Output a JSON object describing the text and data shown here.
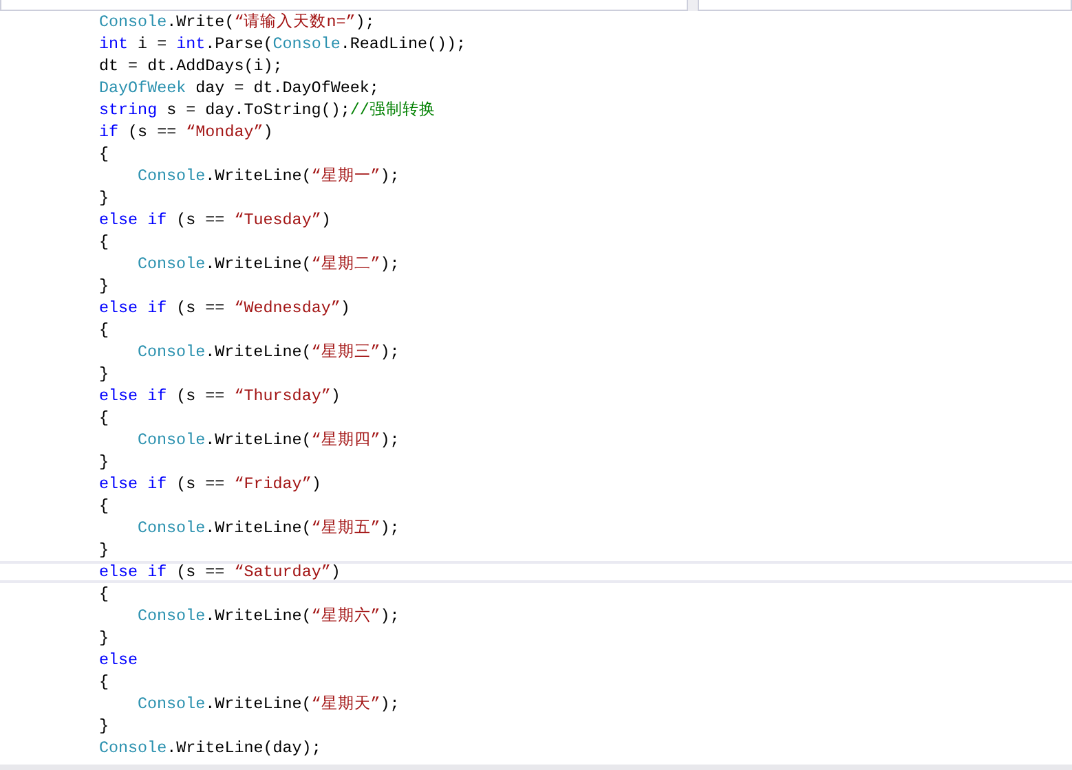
{
  "code_lines": [
    {
      "current": false,
      "tokens": [
        {
          "kind": "type",
          "text": "Console"
        },
        {
          "kind": "plain",
          "text": ".Write("
        },
        {
          "kind": "string",
          "text": "“请输入天数n=”"
        },
        {
          "kind": "plain",
          "text": ");"
        }
      ]
    },
    {
      "current": false,
      "tokens": [
        {
          "kind": "keyword",
          "text": "int"
        },
        {
          "kind": "plain",
          "text": " i = "
        },
        {
          "kind": "keyword",
          "text": "int"
        },
        {
          "kind": "plain",
          "text": ".Parse("
        },
        {
          "kind": "type",
          "text": "Console"
        },
        {
          "kind": "plain",
          "text": ".ReadLine());"
        }
      ]
    },
    {
      "current": false,
      "tokens": [
        {
          "kind": "plain",
          "text": "dt = dt.AddDays(i);"
        }
      ]
    },
    {
      "current": false,
      "tokens": [
        {
          "kind": "type",
          "text": "DayOfWeek"
        },
        {
          "kind": "plain",
          "text": " day = dt.DayOfWeek;"
        }
      ]
    },
    {
      "current": false,
      "tokens": [
        {
          "kind": "keyword",
          "text": "string"
        },
        {
          "kind": "plain",
          "text": " s = day.ToString();"
        },
        {
          "kind": "comment",
          "text": "//强制转换"
        }
      ]
    },
    {
      "current": false,
      "tokens": [
        {
          "kind": "keyword",
          "text": "if"
        },
        {
          "kind": "plain",
          "text": " (s == "
        },
        {
          "kind": "string",
          "text": "“Monday”"
        },
        {
          "kind": "plain",
          "text": ")"
        }
      ]
    },
    {
      "current": false,
      "tokens": [
        {
          "kind": "plain",
          "text": "{"
        }
      ],
      "children": [
        {
          "current": false,
          "tokens": [
            {
              "kind": "type",
              "text": "Console"
            },
            {
              "kind": "plain",
              "text": ".WriteLine("
            },
            {
              "kind": "string",
              "text": "“星期一”"
            },
            {
              "kind": "plain",
              "text": ");"
            }
          ]
        }
      ]
    },
    {
      "current": false,
      "tokens": [
        {
          "kind": "plain",
          "text": "}"
        }
      ]
    },
    {
      "current": false,
      "tokens": [
        {
          "kind": "keyword",
          "text": "else if"
        },
        {
          "kind": "plain",
          "text": " (s == "
        },
        {
          "kind": "string",
          "text": "“Tuesday”"
        },
        {
          "kind": "plain",
          "text": ")"
        }
      ]
    },
    {
      "current": false,
      "tokens": [
        {
          "kind": "plain",
          "text": "{"
        }
      ],
      "children": [
        {
          "current": false,
          "tokens": [
            {
              "kind": "type",
              "text": "Console"
            },
            {
              "kind": "plain",
              "text": ".WriteLine("
            },
            {
              "kind": "string",
              "text": "“星期二”"
            },
            {
              "kind": "plain",
              "text": ");"
            }
          ]
        }
      ]
    },
    {
      "current": false,
      "tokens": [
        {
          "kind": "plain",
          "text": "}"
        }
      ]
    },
    {
      "current": false,
      "tokens": [
        {
          "kind": "keyword",
          "text": "else if"
        },
        {
          "kind": "plain",
          "text": " (s == "
        },
        {
          "kind": "string",
          "text": "“Wednesday”"
        },
        {
          "kind": "plain",
          "text": ")"
        }
      ]
    },
    {
      "current": false,
      "tokens": [
        {
          "kind": "plain",
          "text": "{"
        }
      ],
      "children": [
        {
          "current": false,
          "tokens": [
            {
              "kind": "type",
              "text": "Console"
            },
            {
              "kind": "plain",
              "text": ".WriteLine("
            },
            {
              "kind": "string",
              "text": "“星期三”"
            },
            {
              "kind": "plain",
              "text": ");"
            }
          ]
        }
      ]
    },
    {
      "current": false,
      "tokens": [
        {
          "kind": "plain",
          "text": "}"
        }
      ]
    },
    {
      "current": false,
      "tokens": [
        {
          "kind": "keyword",
          "text": "else if"
        },
        {
          "kind": "plain",
          "text": " (s == "
        },
        {
          "kind": "string",
          "text": "“Thursday”"
        },
        {
          "kind": "plain",
          "text": ")"
        }
      ]
    },
    {
      "current": false,
      "tokens": [
        {
          "kind": "plain",
          "text": "{"
        }
      ],
      "children": [
        {
          "current": false,
          "tokens": [
            {
              "kind": "type",
              "text": "Console"
            },
            {
              "kind": "plain",
              "text": ".WriteLine("
            },
            {
              "kind": "string",
              "text": "“星期四”"
            },
            {
              "kind": "plain",
              "text": ");"
            }
          ]
        }
      ]
    },
    {
      "current": false,
      "tokens": [
        {
          "kind": "plain",
          "text": "}"
        }
      ]
    },
    {
      "current": false,
      "tokens": [
        {
          "kind": "keyword",
          "text": "else if"
        },
        {
          "kind": "plain",
          "text": " (s == "
        },
        {
          "kind": "string",
          "text": "“Friday”"
        },
        {
          "kind": "plain",
          "text": ")"
        }
      ]
    },
    {
      "current": false,
      "tokens": [
        {
          "kind": "plain",
          "text": "{"
        }
      ],
      "children": [
        {
          "current": false,
          "tokens": [
            {
              "kind": "type",
              "text": "Console"
            },
            {
              "kind": "plain",
              "text": ".WriteLine("
            },
            {
              "kind": "string",
              "text": "“星期五”"
            },
            {
              "kind": "plain",
              "text": ");"
            }
          ]
        }
      ]
    },
    {
      "current": false,
      "tokens": [
        {
          "kind": "plain",
          "text": "}"
        }
      ]
    },
    {
      "current": true,
      "tokens": [
        {
          "kind": "keyword",
          "text": "else if"
        },
        {
          "kind": "plain",
          "text": " (s == "
        },
        {
          "kind": "string",
          "text": "“Saturday”"
        },
        {
          "kind": "plain",
          "text": ")"
        }
      ]
    },
    {
      "current": false,
      "tokens": [
        {
          "kind": "plain",
          "text": "{"
        }
      ],
      "children": [
        {
          "current": false,
          "tokens": [
            {
              "kind": "type",
              "text": "Console"
            },
            {
              "kind": "plain",
              "text": ".WriteLine("
            },
            {
              "kind": "string",
              "text": "“星期六”"
            },
            {
              "kind": "plain",
              "text": ");"
            }
          ]
        }
      ]
    },
    {
      "current": false,
      "tokens": [
        {
          "kind": "plain",
          "text": "}"
        }
      ]
    },
    {
      "current": false,
      "tokens": [
        {
          "kind": "keyword",
          "text": "else"
        }
      ]
    },
    {
      "current": false,
      "tokens": [
        {
          "kind": "plain",
          "text": "{"
        }
      ],
      "children": [
        {
          "current": false,
          "tokens": [
            {
              "kind": "type",
              "text": "Console"
            },
            {
              "kind": "plain",
              "text": ".WriteLine("
            },
            {
              "kind": "string",
              "text": "“星期天”"
            },
            {
              "kind": "plain",
              "text": ");"
            }
          ]
        }
      ]
    },
    {
      "current": false,
      "tokens": [
        {
          "kind": "plain",
          "text": "}"
        }
      ]
    },
    {
      "current": false,
      "tokens": [
        {
          "kind": "type",
          "text": "Console"
        },
        {
          "kind": "plain",
          "text": ".WriteLine(day);"
        }
      ]
    }
  ]
}
